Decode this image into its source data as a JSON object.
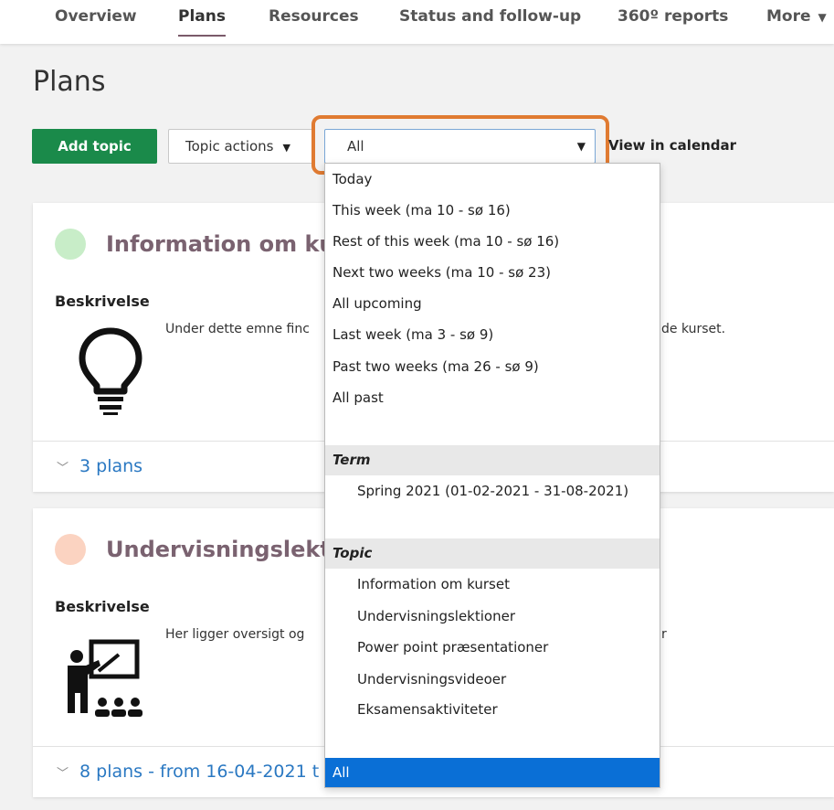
{
  "nav": {
    "items": [
      {
        "label": "Overview",
        "active": false
      },
      {
        "label": "Plans",
        "active": true
      },
      {
        "label": "Resources",
        "active": false
      },
      {
        "label": "Status and follow-up",
        "active": false
      },
      {
        "label": "360º reports",
        "active": false
      },
      {
        "label": "More",
        "active": false
      }
    ]
  },
  "page": {
    "title": "Plans"
  },
  "toolbar": {
    "add_label": "Add topic",
    "actions_label": "Topic actions",
    "select_value": "All",
    "calendar_label": "View in calendar"
  },
  "cards": [
    {
      "title": "Information om ku",
      "dot_color": "#c8edc8",
      "label": "Beskrivelse",
      "desc_start": "Under dette emne finc",
      "desc_end": "de kurset.",
      "footer": "3 plans",
      "icon": "lightbulb-icon"
    },
    {
      "title": "Undervisningslekti",
      "dot_color": "#fbd3c1",
      "label": "Beskrivelse",
      "desc_start": "Her ligger oversigt og",
      "desc_end": "r",
      "footer": "8 plans - from 16-04-2021 t",
      "icon": "teacher-presentation-icon"
    }
  ],
  "dropdown": {
    "partial_top": "Today",
    "options": [
      "This week (ma 10 - sø 16)",
      "Rest of this week (ma 10 - sø 16)",
      "Next two weeks (ma 10 - sø 23)",
      "All upcoming",
      "Last week (ma 3 - sø 9)",
      "Past two weeks (ma 26 - sø 9)",
      "All past"
    ],
    "term_label": "Term",
    "term_options": [
      "Spring 2021 (01-02-2021 - 31-08-2021)"
    ],
    "topic_label": "Topic",
    "topic_options": [
      "Information om kurset",
      "Undervisningslektioner",
      "Power point præsentationer",
      "Undervisningsvideoer",
      "Eksamensaktiviteter"
    ],
    "selected": "All"
  },
  "colors": {
    "accent_green": "#1a8a4a",
    "highlight_orange": "#e07b32",
    "link_blue": "#2a78c2",
    "selected_blue": "#0a6fd6"
  }
}
